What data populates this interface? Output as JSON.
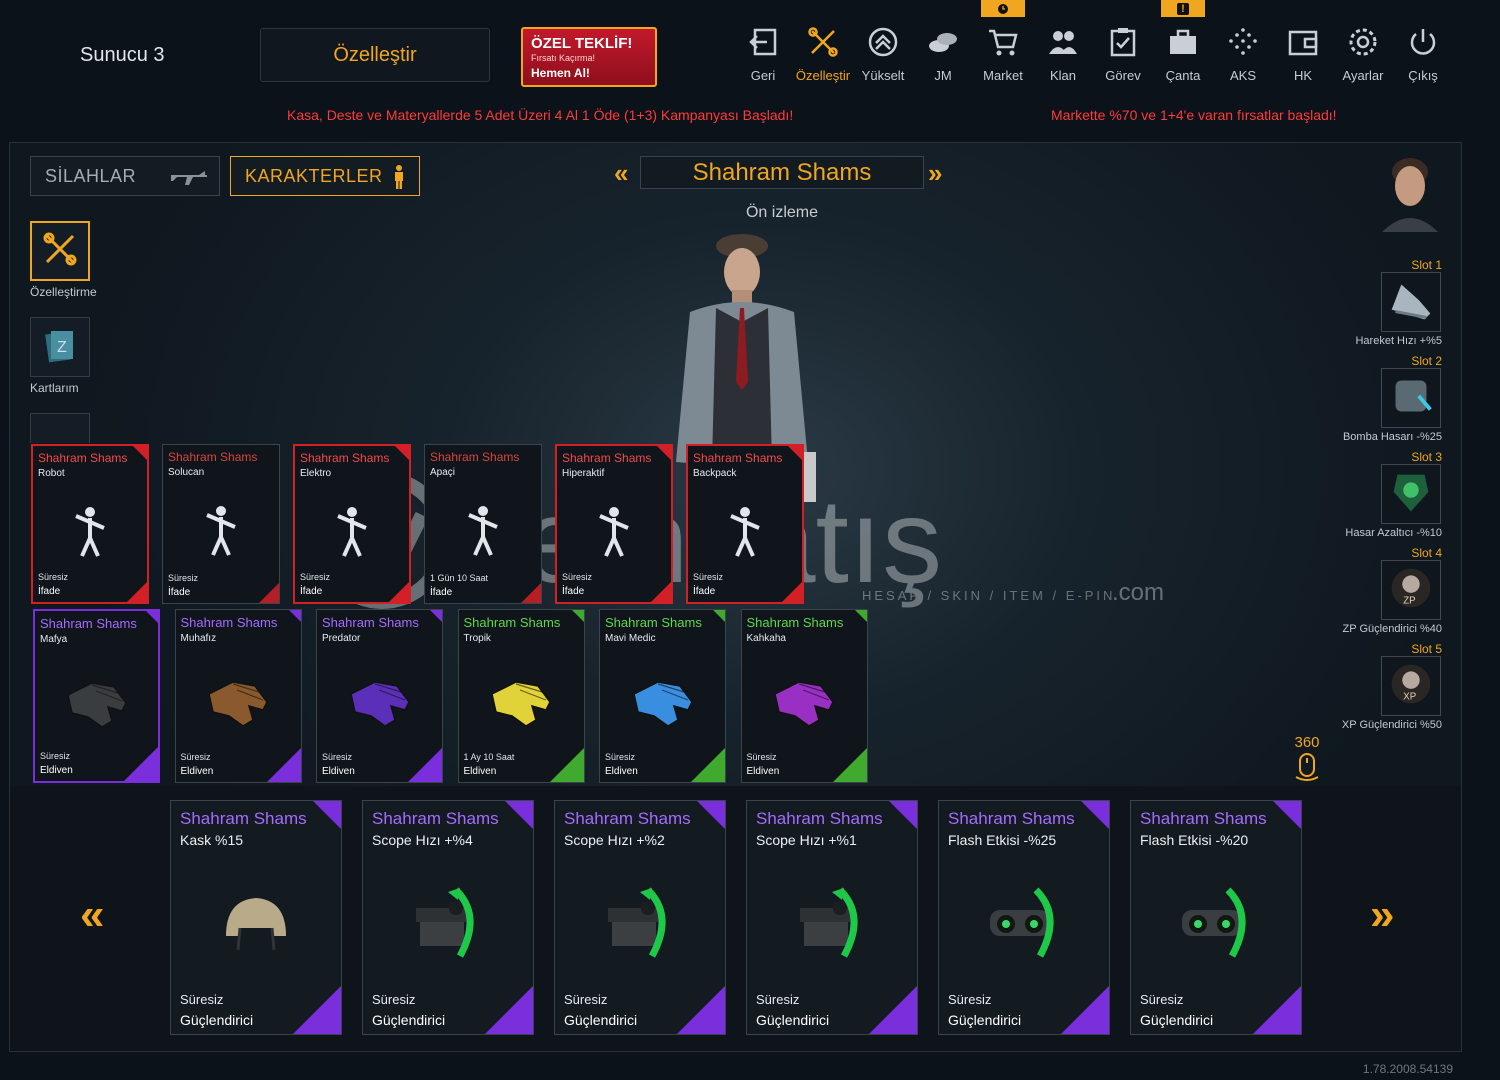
{
  "header": {
    "server": "Sunucu 3",
    "customize_button": "Özelleştir",
    "offer": {
      "title": "ÖZEL TEKLİF!",
      "subtitle": "Fırsatı Kaçırma!",
      "cta": "Hemen Al!"
    },
    "nav": [
      {
        "label": "Geri",
        "icon": "back-icon"
      },
      {
        "label": "Özelleştir",
        "icon": "tools-icon"
      },
      {
        "label": "Yükselt",
        "icon": "upgrade-icon"
      },
      {
        "label": "JM",
        "icon": "coins-icon"
      },
      {
        "label": "Market",
        "icon": "cart-icon"
      },
      {
        "label": "Klan",
        "icon": "clan-icon"
      },
      {
        "label": "Görev",
        "icon": "mission-icon"
      },
      {
        "label": "Çanta",
        "icon": "bag-icon"
      },
      {
        "label": "AKS",
        "icon": "aks-icon"
      },
      {
        "label": "HK",
        "icon": "wallet-icon"
      },
      {
        "label": "Ayarlar",
        "icon": "gear-icon"
      },
      {
        "label": "Çıkış",
        "icon": "power-icon"
      }
    ],
    "badge_market": "clock-icon",
    "badge_bag": "!"
  },
  "promos": {
    "left": "Kasa, Deste ve Materyallerde 5 Adet Üzeri 4 Al 1 Öde (1+3) Kampanyası Başladı!",
    "right": "Markette %70 ve 1+4'e varan fırsatlar başladı!"
  },
  "tabs": {
    "weapons": "SİLAHLAR",
    "characters": "KARAKTERLER"
  },
  "character": {
    "name": "Shahram Shams",
    "preview": "Ön izleme"
  },
  "side_menu": [
    {
      "label": "Özelleştirme",
      "icon": "tools-icon"
    },
    {
      "label": "Kartlarım",
      "icon": "cards-icon"
    }
  ],
  "slots": [
    {
      "label": "Slot 1",
      "desc": "Hareket Hızı +%5"
    },
    {
      "label": "Slot 2",
      "desc": "Bomba Hasarı -%25"
    },
    {
      "label": "Slot 3",
      "desc": "Hasar Azaltıcı -%10"
    },
    {
      "label": "Slot 4",
      "desc": "ZP Güçlendirici %40"
    },
    {
      "label": "Slot 5",
      "desc": "XP Güçlendirici %50"
    }
  ],
  "rotate_label": "360",
  "emotes": [
    {
      "name": "Shahram Shams",
      "sub": "Robot",
      "duration": "Süresiz",
      "type": "İfade"
    },
    {
      "name": "Shahram Shams",
      "sub": "Solucan",
      "duration": "Süresiz",
      "type": "İfade"
    },
    {
      "name": "Shahram Shams",
      "sub": "Elektro",
      "duration": "Süresiz",
      "type": "İfade"
    },
    {
      "name": "Shahram Shams",
      "sub": "Apaçi",
      "duration": "1 Gün 10 Saat",
      "type": "İfade"
    },
    {
      "name": "Shahram Shams",
      "sub": "Hiperaktif",
      "duration": "Süresiz",
      "type": "İfade"
    },
    {
      "name": "Shahram Shams",
      "sub": "Backpack",
      "duration": "Süresiz",
      "type": "İfade"
    }
  ],
  "gloves": [
    {
      "name": "Shahram Shams",
      "sub": "Mafya",
      "duration": "Süresiz",
      "type": "Eldiven",
      "rarity": "purple",
      "color": "#3a3d40"
    },
    {
      "name": "Shahram Shams",
      "sub": "Muhafız",
      "duration": "Süresiz",
      "type": "Eldiven",
      "rarity": "purple",
      "color": "#8a5a2e"
    },
    {
      "name": "Shahram Shams",
      "sub": "Predator",
      "duration": "Süresiz",
      "type": "Eldiven",
      "rarity": "purple",
      "color": "#5b2fb8"
    },
    {
      "name": "Shahram Shams",
      "sub": "Tropik",
      "duration": "1 Ay 10 Saat",
      "type": "Eldiven",
      "rarity": "green",
      "color": "#e2d23a"
    },
    {
      "name": "Shahram Shams",
      "sub": "Mavi Medic",
      "duration": "Süresiz",
      "type": "Eldiven",
      "rarity": "green",
      "color": "#3a8ee0"
    },
    {
      "name": "Shahram Shams",
      "sub": "Kahkaha",
      "duration": "Süresiz",
      "type": "Eldiven",
      "rarity": "green",
      "color": "#9a2fc4"
    }
  ],
  "boosters": [
    {
      "name": "Shahram Shams",
      "sub": "Kask %15",
      "duration": "Süresiz",
      "type": "Güçlendirici",
      "icon": "helmet-icon"
    },
    {
      "name": "Shahram Shams",
      "sub": "Scope Hızı +%4",
      "duration": "Süresiz",
      "type": "Güçlendirici",
      "icon": "scope-icon"
    },
    {
      "name": "Shahram Shams",
      "sub": "Scope Hızı +%2",
      "duration": "Süresiz",
      "type": "Güçlendirici",
      "icon": "scope-icon"
    },
    {
      "name": "Shahram Shams",
      "sub": "Scope Hızı +%1",
      "duration": "Süresiz",
      "type": "Güçlendirici",
      "icon": "scope-icon"
    },
    {
      "name": "Shahram Shams",
      "sub": "Flash Etkisi -%25",
      "duration": "Süresiz",
      "type": "Güçlendirici",
      "icon": "goggles-icon"
    },
    {
      "name": "Shahram Shams",
      "sub": "Flash Etkisi -%20",
      "duration": "Süresiz",
      "type": "Güçlendirici",
      "icon": "goggles-icon"
    }
  ],
  "version": "1.78.2008.54139",
  "watermark": {
    "brand": "itemsatış",
    "tagline": "HESAP / SKIN / ITEM / E-PIN",
    "suffix": ".com"
  },
  "colors": {
    "accent": "#f0a61f",
    "red_rarity": "#d32027",
    "purple_rarity": "#7b2fdc",
    "green_rarity": "#3faa2e"
  }
}
